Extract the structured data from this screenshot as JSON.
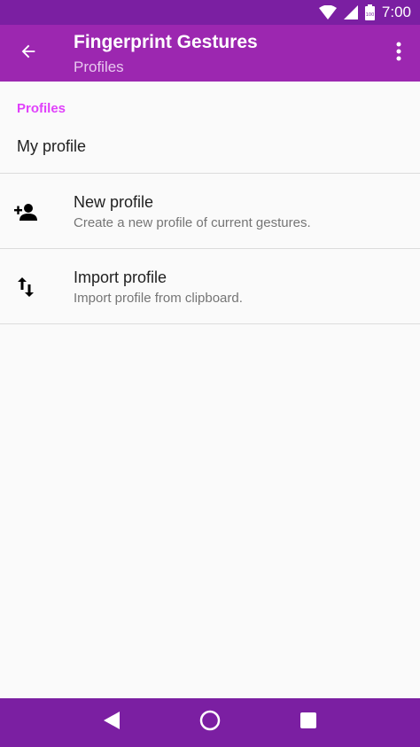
{
  "status_bar": {
    "time": "7:00",
    "icons": [
      "wifi-icon",
      "signal-icon",
      "battery-icon"
    ],
    "battery_label": "100"
  },
  "app_bar": {
    "title": "Fingerprint Gestures",
    "subtitle": "Profiles",
    "back_icon": "arrow-back-icon",
    "menu_icon": "more-vert-icon"
  },
  "content": {
    "category_title": "Profiles",
    "current_profile": "My profile",
    "items": [
      {
        "title": "New profile",
        "summary": "Create a new profile of current gestures.",
        "icon": "person-add-icon"
      },
      {
        "title": "Import profile",
        "summary": "Import profile from clipboard.",
        "icon": "import-export-icon"
      }
    ]
  },
  "nav_bar": {
    "buttons": [
      "back-nav-icon",
      "home-nav-icon",
      "recents-nav-icon"
    ]
  },
  "colors": {
    "status_bar": "#7b1fa2",
    "app_bar": "#9c27b0",
    "accent": "#e040fb",
    "background": "#fafafa"
  }
}
